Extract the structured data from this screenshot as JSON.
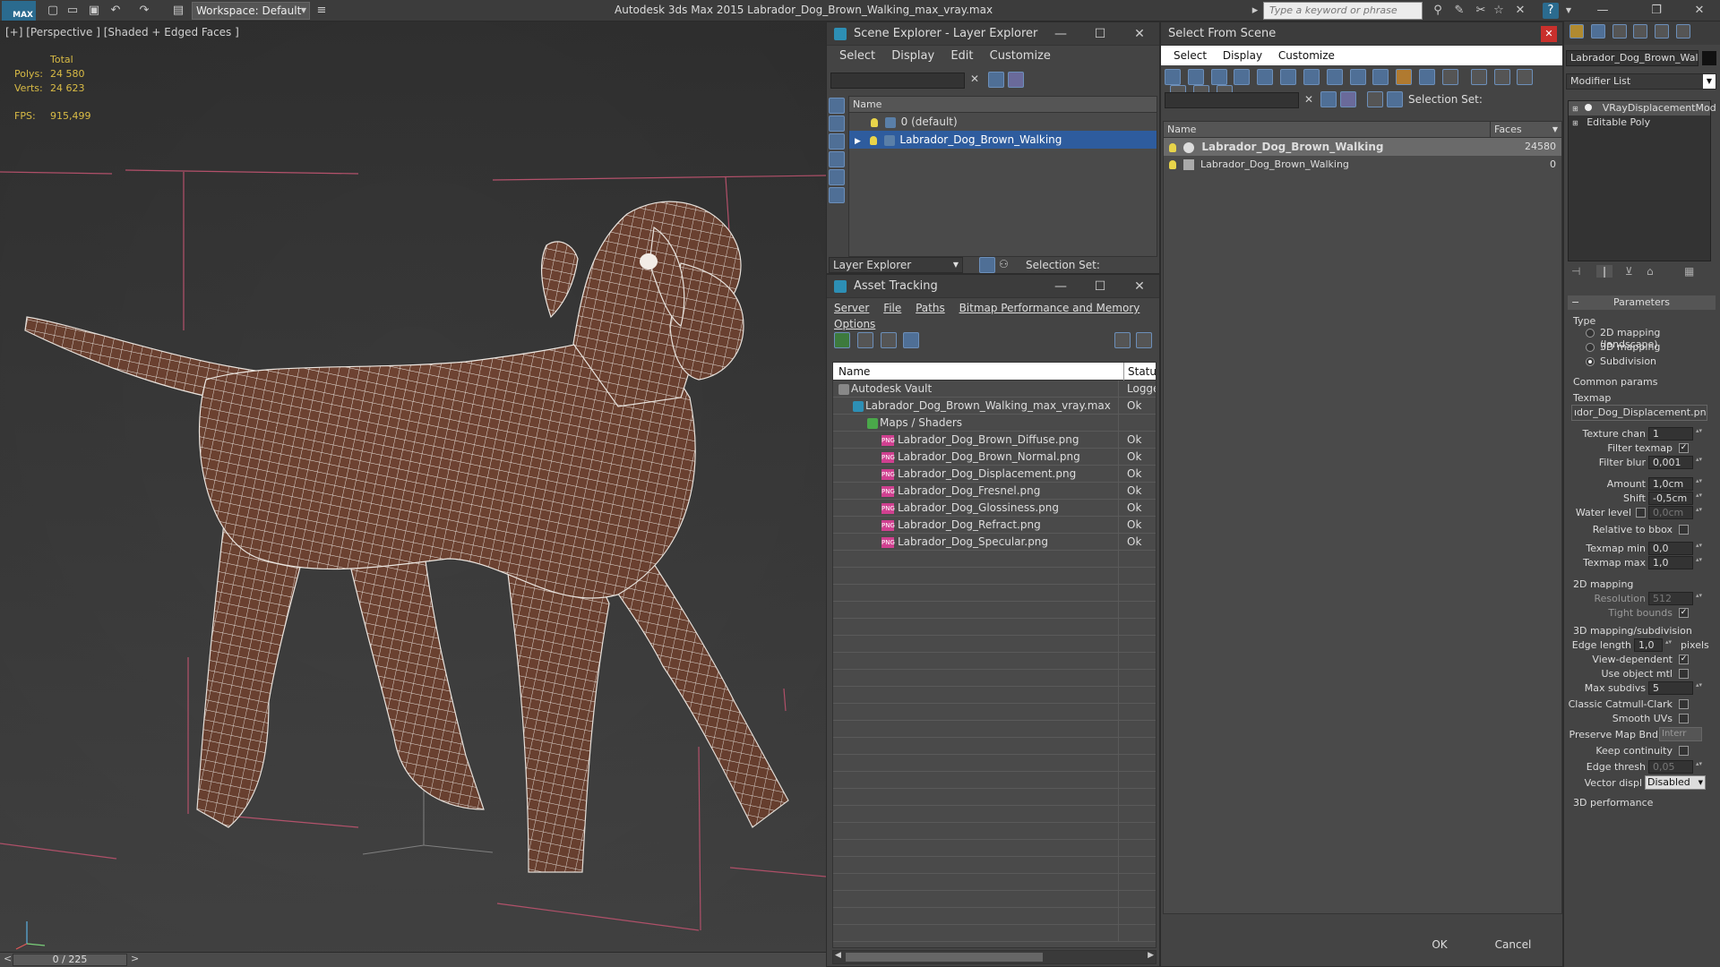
{
  "app": {
    "logo": "MAX",
    "workspace": "Workspace: Default",
    "title": "Autodesk 3ds Max  2015    Labrador_Dog_Brown_Walking_max_vray.max",
    "search_placeholder": "Type a keyword or phrase"
  },
  "viewport": {
    "label": "[+] [Perspective ] [Shaded + Edged Faces ]",
    "stats": {
      "total_label": "Total",
      "polys_label": "Polys:",
      "polys_value": "24 580",
      "verts_label": "Verts:",
      "verts_value": "24 623",
      "fps_label": "FPS:",
      "fps_value": "915,499"
    },
    "timeline": "0 / 225"
  },
  "scene_explorer": {
    "title": "Scene Explorer - Layer Explorer",
    "menu": [
      "Select",
      "Display",
      "Edit",
      "Customize"
    ],
    "column": "Name",
    "rows": [
      {
        "label": "0 (default)",
        "selected": false
      },
      {
        "label": "Labrador_Dog_Brown_Walking",
        "selected": true
      }
    ],
    "footer_dropdown": "Layer Explorer",
    "selection_set_label": "Selection Set:"
  },
  "asset_tracking": {
    "title": "Asset Tracking",
    "menu": [
      "Server",
      "File",
      "Paths",
      "Bitmap Performance and Memory",
      "Options"
    ],
    "columns": [
      "Name",
      "Status"
    ],
    "rows": [
      {
        "indent": 0,
        "icon": "vault",
        "name": "Autodesk Vault",
        "status": "Logged"
      },
      {
        "indent": 1,
        "icon": "max-file",
        "name": "Labrador_Dog_Brown_Walking_max_vray.max",
        "status": "Ok"
      },
      {
        "indent": 2,
        "icon": "maps",
        "name": "Maps / Shaders",
        "status": ""
      },
      {
        "indent": 3,
        "icon": "png",
        "name": "Labrador_Dog_Brown_Diffuse.png",
        "status": "Ok"
      },
      {
        "indent": 3,
        "icon": "png",
        "name": "Labrador_Dog_Brown_Normal.png",
        "status": "Ok"
      },
      {
        "indent": 3,
        "icon": "png",
        "name": "Labrador_Dog_Displacement.png",
        "status": "Ok"
      },
      {
        "indent": 3,
        "icon": "png",
        "name": "Labrador_Dog_Fresnel.png",
        "status": "Ok"
      },
      {
        "indent": 3,
        "icon": "png",
        "name": "Labrador_Dog_Glossiness.png",
        "status": "Ok"
      },
      {
        "indent": 3,
        "icon": "png",
        "name": "Labrador_Dog_Refract.png",
        "status": "Ok"
      },
      {
        "indent": 3,
        "icon": "png",
        "name": "Labrador_Dog_Specular.png",
        "status": "Ok"
      }
    ],
    "png_badge": "PNG"
  },
  "select_from_scene": {
    "title": "Select From Scene",
    "menu": [
      "Select",
      "Display",
      "Customize"
    ],
    "selection_set_label": "Selection Set:",
    "columns": [
      "Name",
      "Faces"
    ],
    "rows": [
      {
        "name": "Labrador_Dog_Brown_Walking",
        "faces": "24580",
        "bold": true
      },
      {
        "name": "Labrador_Dog_Brown_Walking",
        "faces": "0",
        "bold": false
      }
    ],
    "ok": "OK",
    "cancel": "Cancel"
  },
  "command_panel": {
    "object_name": "Labrador_Dog_Brown_Walkin",
    "modifier_list": "Modifier List",
    "stack": [
      "VRayDisplacementMod",
      "Editable Poly"
    ],
    "rollout": "Parameters",
    "type_label": "Type",
    "type_options": [
      "2D mapping (landscape)",
      "3D mapping",
      "Subdivision"
    ],
    "type_selected": 2,
    "common_params": "Common params",
    "texmap_label": "Texmap",
    "texmap_value": "ıdor_Dog_Displacement.png)",
    "texture_chan_label": "Texture chan",
    "texture_chan_value": "1",
    "filter_texmap_label": "Filter texmap",
    "filter_blur_label": "Filter blur",
    "filter_blur_value": "0,001",
    "amount_label": "Amount",
    "amount_value": "1,0cm",
    "shift_label": "Shift",
    "shift_value": "-0,5cm",
    "water_level_label": "Water level",
    "water_level_value": "0,0cm",
    "relative_bbox_label": "Relative to bbox",
    "texmap_min_label": "Texmap min",
    "texmap_min_value": "0,0",
    "texmap_max_label": "Texmap max",
    "texmap_max_value": "1,0",
    "mapping2d_label": "2D mapping",
    "resolution_label": "Resolution",
    "resolution_value": "512",
    "tight_bounds_label": "Tight bounds",
    "mapping3d_label": "3D mapping/subdivision",
    "edge_length_label": "Edge length",
    "edge_length_value": "1,0",
    "pixels_label": "pixels",
    "view_dependent_label": "View-dependent",
    "use_object_mtl_label": "Use object mtl",
    "max_subdivs_label": "Max subdivs",
    "max_subdivs_value": "5",
    "classic_cc_label": "Classic Catmull-Clark",
    "smooth_uvs_label": "Smooth UVs",
    "preserve_map_label": "Preserve Map Bnd",
    "preserve_map_value": "Interr",
    "keep_continuity_label": "Keep continuity",
    "edge_thresh_label": "Edge thresh",
    "edge_thresh_value": "0,05",
    "vector_displ_label": "Vector displ",
    "vector_displ_value": "Disabled",
    "perf_label": "3D performance"
  }
}
